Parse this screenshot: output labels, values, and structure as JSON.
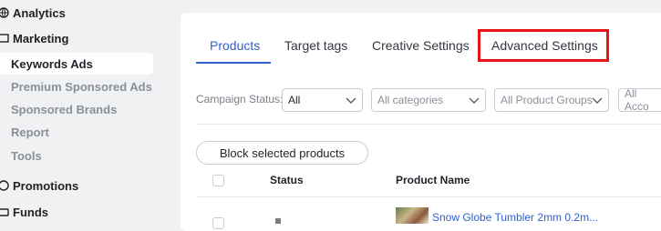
{
  "sidebar": {
    "items": [
      {
        "label": "Analytics",
        "type": "section",
        "icon": "globe-icon"
      },
      {
        "label": "Marketing",
        "type": "section",
        "icon": "marketing-icon"
      },
      {
        "label": "Keywords Ads",
        "type": "sub",
        "active": true
      },
      {
        "label": "Premium Sponsored Ads",
        "type": "sub"
      },
      {
        "label": "Sponsored Brands",
        "type": "sub"
      },
      {
        "label": "Report",
        "type": "sub"
      },
      {
        "label": "Tools",
        "type": "sub"
      },
      {
        "label": "Promotions",
        "type": "section",
        "icon": "promotions-icon"
      },
      {
        "label": "Funds",
        "type": "section",
        "icon": "funds-icon"
      }
    ]
  },
  "tabs": [
    {
      "label": "Products",
      "active": true
    },
    {
      "label": "Target tags"
    },
    {
      "label": "Creative Settings"
    },
    {
      "label": "Advanced Settings",
      "highlighted": true
    }
  ],
  "filters": {
    "campaign_status_label": "Campaign Status:",
    "campaign_status_value": "All",
    "categories_placeholder": "All categories",
    "product_groups_placeholder": "All Product Groups",
    "accounts_placeholder": "All Acco"
  },
  "actions": {
    "block_selected": "Block selected products"
  },
  "table": {
    "headers": {
      "status": "Status",
      "product_name": "Product Name"
    },
    "rows": [
      {
        "product_name": "Snow Globe Tumbler 2mm 0.2m..."
      }
    ]
  },
  "colors": {
    "accent": "#2f5fd0",
    "highlight": "#e8141b",
    "sidebar_bg": "#f0f1f3"
  }
}
